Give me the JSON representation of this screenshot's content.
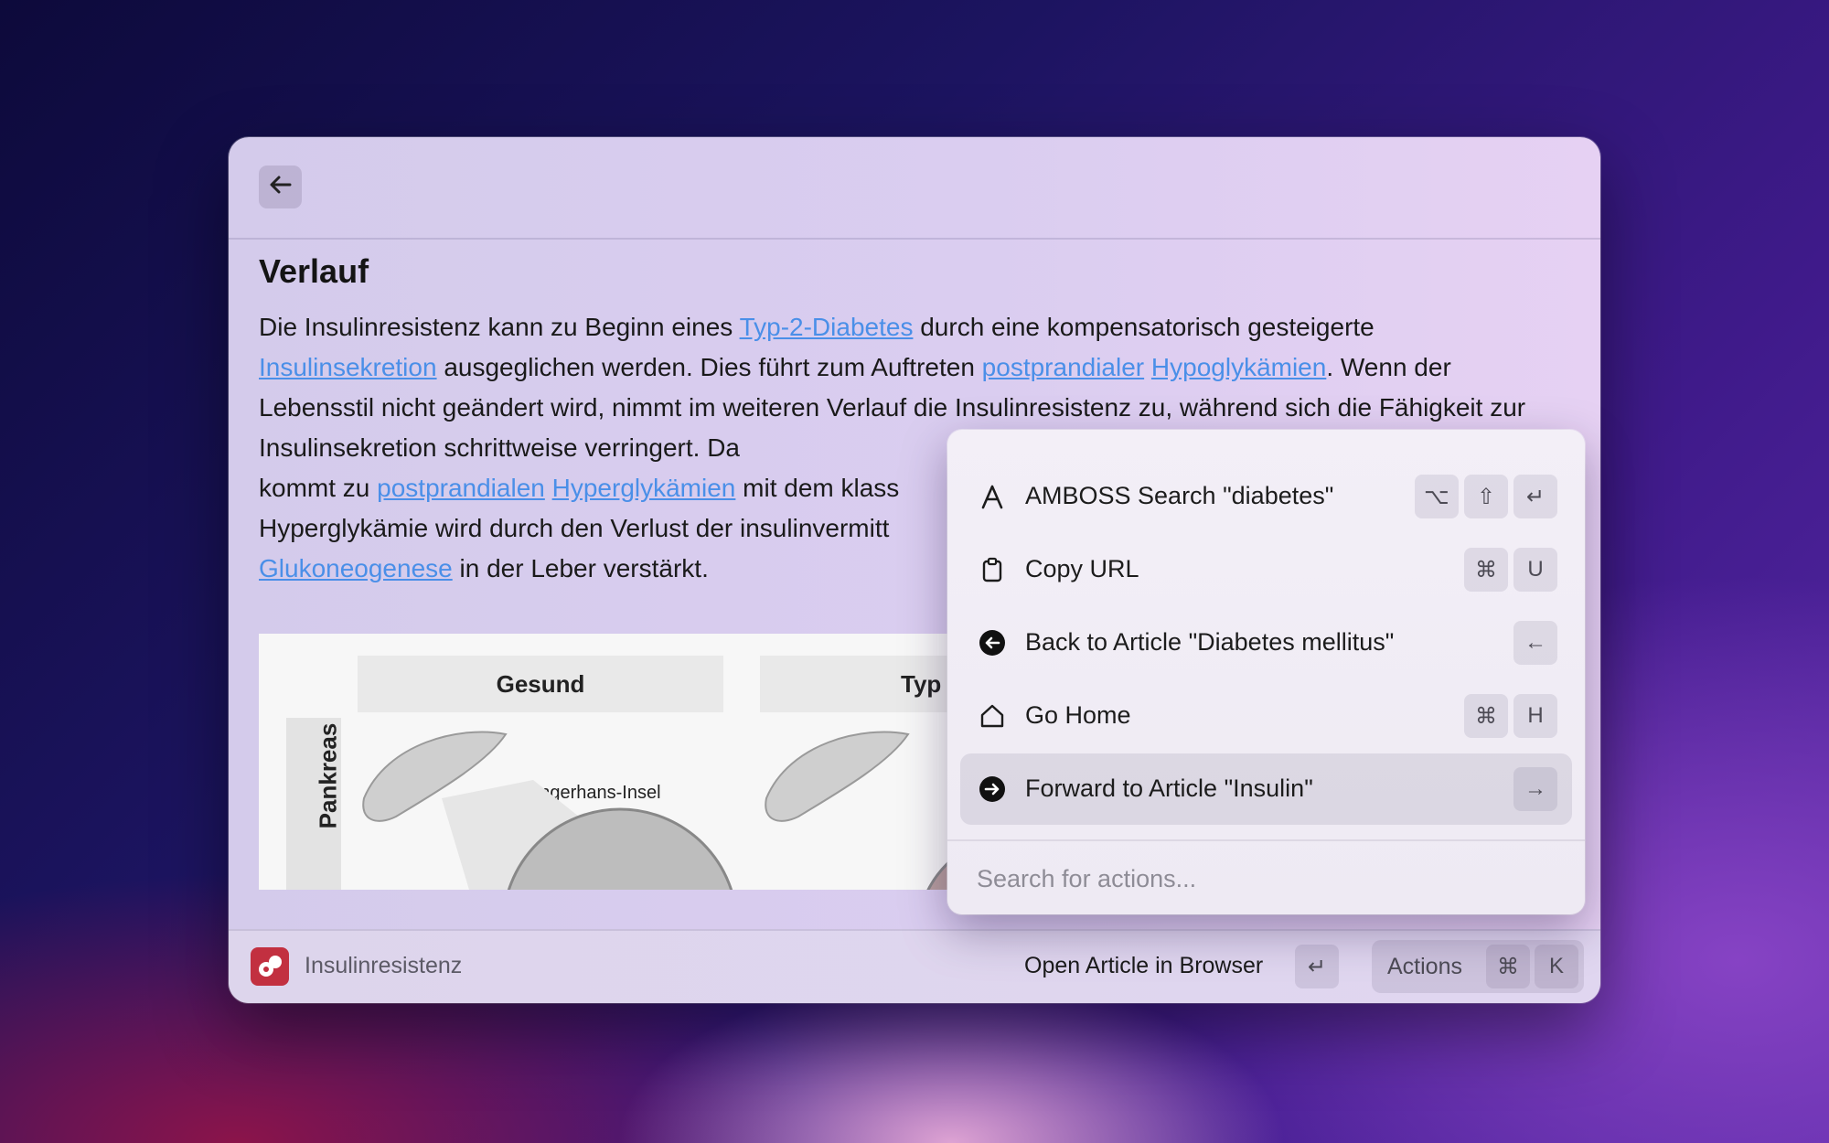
{
  "article": {
    "heading": "Verlauf",
    "paragraph_segments": [
      {
        "text": "Die Insulinresistenz kann zu Beginn eines ",
        "link": false
      },
      {
        "text": "Typ-2-Diabetes",
        "link": true
      },
      {
        "text": " durch eine kompensatorisch gesteigerte ",
        "link": false
      },
      {
        "text": "Insulinsekretion",
        "link": true
      },
      {
        "text": " ausgeglichen werden. Dies führt zum Auftreten ",
        "link": false
      },
      {
        "text": "postprandialer",
        "link": true
      },
      {
        "text": " ",
        "link": false
      },
      {
        "text": "Hypoglykämien",
        "link": true
      },
      {
        "text": ". Wenn der Lebensstil nicht geändert wird, nimmt im weiteren Verlauf die Insulinresistenz zu, während sich die Fähigkeit zur Insulinsekretion schrittweise verringert. Da",
        "link": false
      },
      {
        "text": " kommt zu ",
        "link": false
      },
      {
        "text": "postprandialen",
        "link": true
      },
      {
        "text": " ",
        "link": false
      },
      {
        "text": "Hyperglykämien",
        "link": true
      },
      {
        "text": " mit dem klass",
        "link": false
      },
      {
        "text": " Hyperglykämie wird durch den Verlust der insulinvermitt",
        "link": false
      },
      {
        "text": " ",
        "link": false
      },
      {
        "text": "Glukoneogenese",
        "link": true
      },
      {
        "text": " in der Leber verstärkt.",
        "link": false
      }
    ],
    "figure": {
      "col1": "Gesund",
      "col2": "Typ I Di",
      "row1": "Pankreas",
      "label_islet": "Langerhans-Insel"
    }
  },
  "bottombar": {
    "app_title": "Insulinresistenz",
    "primary_action": "Open Article in Browser",
    "primary_key": "↵",
    "actions_label": "Actions",
    "actions_keys": [
      "⌘",
      "K"
    ]
  },
  "panel": {
    "items": [
      {
        "label": "AMBOSS Search \"diabetes\"",
        "icon": "amboss-a-icon",
        "keys": [
          "⌥",
          "⇧",
          "↵"
        ],
        "selected": false
      },
      {
        "label": "Copy URL",
        "icon": "clipboard-icon",
        "keys": [
          "⌘",
          "U"
        ],
        "selected": false
      },
      {
        "label": "Back to Article  \"Diabetes mellitus\"",
        "icon": "arrow-left-circle-icon",
        "keys": [
          "←"
        ],
        "selected": false
      },
      {
        "label": "Go Home",
        "icon": "home-icon",
        "keys": [
          "⌘",
          "H"
        ],
        "selected": false
      },
      {
        "label": "Forward to Article \"Insulin\"",
        "icon": "arrow-right-circle-icon",
        "keys": [
          "→"
        ],
        "selected": true
      }
    ],
    "search_placeholder": "Search for actions..."
  }
}
